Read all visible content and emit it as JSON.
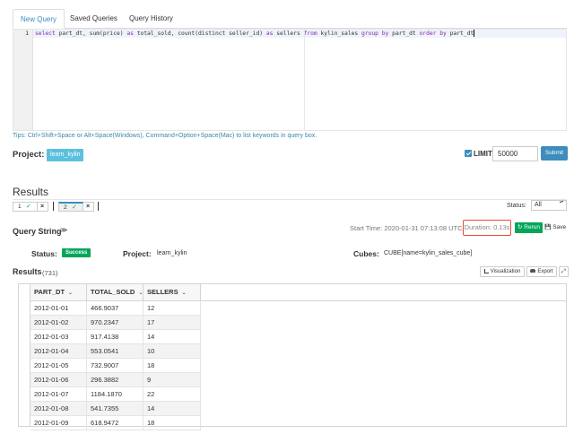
{
  "tabs": [
    "New Query",
    "Saved Queries",
    "Query History"
  ],
  "editor": {
    "line_number": "1",
    "sql_tokens": [
      {
        "t": "select",
        "kw": true
      },
      {
        "t": " part_dt, sum(price) ",
        "kw": false
      },
      {
        "t": "as",
        "kw": true
      },
      {
        "t": " total_sold, count(distinct seller_id) ",
        "kw": false
      },
      {
        "t": "as",
        "kw": true
      },
      {
        "t": " sellers ",
        "kw": false
      },
      {
        "t": "from",
        "kw": true
      },
      {
        "t": " kylin_sales ",
        "kw": false
      },
      {
        "t": "group by",
        "kw": true
      },
      {
        "t": " part_dt ",
        "kw": false
      },
      {
        "t": "order by",
        "kw": true
      },
      {
        "t": " part_dt",
        "kw": false
      }
    ]
  },
  "tips": "Tips: Ctrl+Shift+Space or Alt+Space(Windows), Command+Option+Space(Mac) to list keywords in query box.",
  "project": {
    "label": "Project:",
    "value": "learn_kylin"
  },
  "limit": {
    "label": "LIMIT",
    "value": "50000",
    "checked": true
  },
  "submit_label": "Submit",
  "results": {
    "title": "Results",
    "query_tabs": [
      {
        "num": "1",
        "ok": "✓",
        "close": "×"
      },
      {
        "num": "2",
        "ok": "✓",
        "close": "×"
      }
    ],
    "status_label": "Status:",
    "status_value": "All"
  },
  "query_string": {
    "label": "Query String",
    "chevron": "≫",
    "start_time": "Start Time: 2020-01-31 07:13:08 UTC",
    "duration": "Duration: 0.13s",
    "rerun_label": "Rerun",
    "rerun_icon": "↻",
    "save_label": "Save",
    "save_icon": "💾"
  },
  "meta": {
    "status_label": "Status:",
    "status_value": "Success",
    "project_label": "Project:",
    "project_value": "learn_kylin",
    "cubes_label": "Cubes:",
    "cubes_value": "CUBE[name=kylin_sales_cube]"
  },
  "results_table": {
    "label": "Results",
    "count": "(731)",
    "visualization_label": "Visualization",
    "export_label": "Export",
    "expand_icon": "⤢",
    "columns": [
      "PART_DT",
      "TOTAL_SOLD",
      "SELLERS"
    ],
    "rows": [
      [
        "2012-01-01",
        "466.9037",
        "12"
      ],
      [
        "2012-01-02",
        "970.2347",
        "17"
      ],
      [
        "2012-01-03",
        "917.4138",
        "14"
      ],
      [
        "2012-01-04",
        "553.0541",
        "10"
      ],
      [
        "2012-01-05",
        "732.9007",
        "18"
      ],
      [
        "2012-01-06",
        "296.3882",
        "9"
      ],
      [
        "2012-01-07",
        "1184.1870",
        "22"
      ],
      [
        "2012-01-08",
        "541.7355",
        "14"
      ],
      [
        "2012-01-09",
        "618.9472",
        "18"
      ]
    ]
  },
  "colors": {
    "primary": "#3c8dbc",
    "info": "#5bc0de",
    "success": "#00a65a",
    "highlight_border": "#e74c3c"
  }
}
